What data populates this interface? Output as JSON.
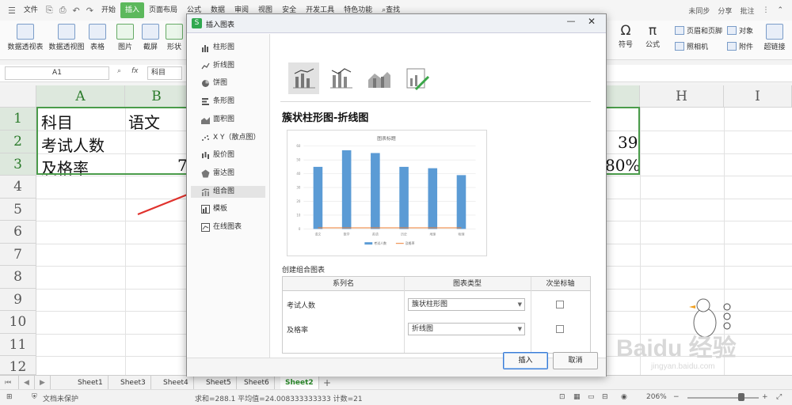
{
  "menubar": {
    "file": "文件",
    "tabs": [
      "开始",
      "插入",
      "页面布局",
      "公式",
      "数据",
      "审阅",
      "视图",
      "安全",
      "开发工具",
      "特色功能"
    ],
    "active_tab": "插入",
    "search": "查找",
    "sync": "未同步",
    "share": "分享",
    "comment": "批注"
  },
  "ribbon": {
    "pivot_table": "数据透视表",
    "pivot_chart": "数据透视图",
    "table": "表格",
    "picture": "图片",
    "screenshot": "截屏",
    "shape": "形状",
    "symbol": "符号",
    "formula": "公式",
    "header_footer": "页眉和页脚",
    "object": "对象",
    "camera": "照相机",
    "attachment": "附件",
    "hyperlink": "超链接"
  },
  "formula_bar": {
    "cell_ref": "A1",
    "fx": "fx",
    "value": "科目"
  },
  "sheet": {
    "columns": [
      "A",
      "B",
      "H",
      "I"
    ],
    "rows": [
      "1",
      "2",
      "3",
      "4",
      "5",
      "6",
      "7",
      "8",
      "9",
      "10",
      "11",
      "12"
    ],
    "a1": "科目",
    "b1": "语文",
    "a2": "考试人数",
    "a3": "及格率",
    "b3": "7",
    "g2": "39",
    "g3": "80%"
  },
  "sheet_tabs": [
    "Sheet1",
    "Sheet3",
    "Sheet4",
    "Sheet5",
    "Sheet6",
    "Sheet2"
  ],
  "active_sheet": "Sheet2",
  "status": {
    "doc": "文档未保护",
    "stats": "求和=288.1   平均值=24.008333333333   计数=21",
    "zoom": "206%"
  },
  "dialog": {
    "title": "插入图表",
    "categories": [
      "柱形图",
      "折线图",
      "饼图",
      "条形图",
      "面积图",
      "X Y（散点图）",
      "股价图",
      "雷达图",
      "组合图",
      "模板",
      "在线图表"
    ],
    "active_category": "组合图",
    "chart_name": "簇状柱形图-折线图",
    "create_label": "创建组合图表",
    "table_headers": [
      "系列名",
      "图表类型",
      "次坐标轴"
    ],
    "rows": [
      {
        "name": "考试人数",
        "type": "簇状柱形图"
      },
      {
        "name": "及格率",
        "type": "折线图"
      }
    ],
    "insert_button": "插入",
    "cancel_button": "取消"
  },
  "chart_data": {
    "type": "bar",
    "title": "图表标题",
    "categories": [
      "语文",
      "数学",
      "英语",
      "历史",
      "地理",
      "物理"
    ],
    "series": [
      {
        "name": "考试人数",
        "values": [
          45,
          57,
          55,
          45,
          44,
          39
        ]
      },
      {
        "name": "及格率",
        "values": [
          0.8,
          0.8,
          0.8,
          0.8,
          0.8,
          0.8
        ]
      }
    ],
    "ylim": [
      0,
      60
    ],
    "yticks": [
      "0",
      "10",
      "20",
      "30",
      "40",
      "50",
      "60"
    ],
    "legend": "bottom",
    "colors": [
      "#5b9bd5",
      "#ed7d31"
    ]
  },
  "watermark": {
    "text": "Baidu 经验",
    "url": "jingyan.baidu.com"
  }
}
